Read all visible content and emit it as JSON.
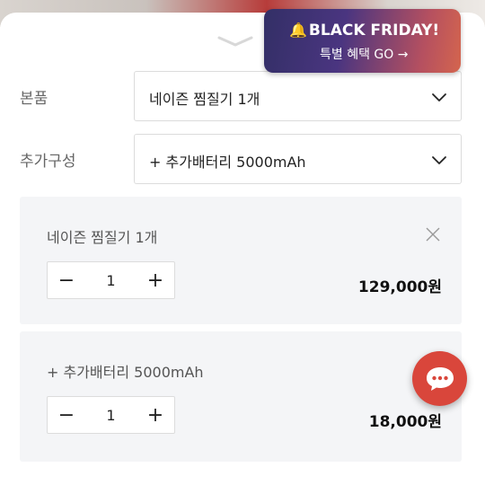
{
  "promo": {
    "title": "BLACK FRIDAY!",
    "subtitle": "특별 혜택 GO →",
    "bell_icon": "bell-icon"
  },
  "options": [
    {
      "label": "본품",
      "selected": "네이즌 찜질기 1개"
    },
    {
      "label": "추가구성",
      "selected": "+ 추가배터리 5000mAh"
    }
  ],
  "selected_items": [
    {
      "name": "네이즌 찜질기 1개",
      "quantity": "1",
      "price": "129,000원",
      "closable": true
    },
    {
      "name": "+ 추가배터리 5000mAh",
      "quantity": "1",
      "price": "18,000원",
      "closable": false
    }
  ],
  "stepper": {
    "minus": "−",
    "plus": "+"
  },
  "colors": {
    "accent_chat": "#d9463b",
    "card_bg": "#f4f5f7",
    "promo_start": "#332f66",
    "promo_end": "#d4654e"
  }
}
